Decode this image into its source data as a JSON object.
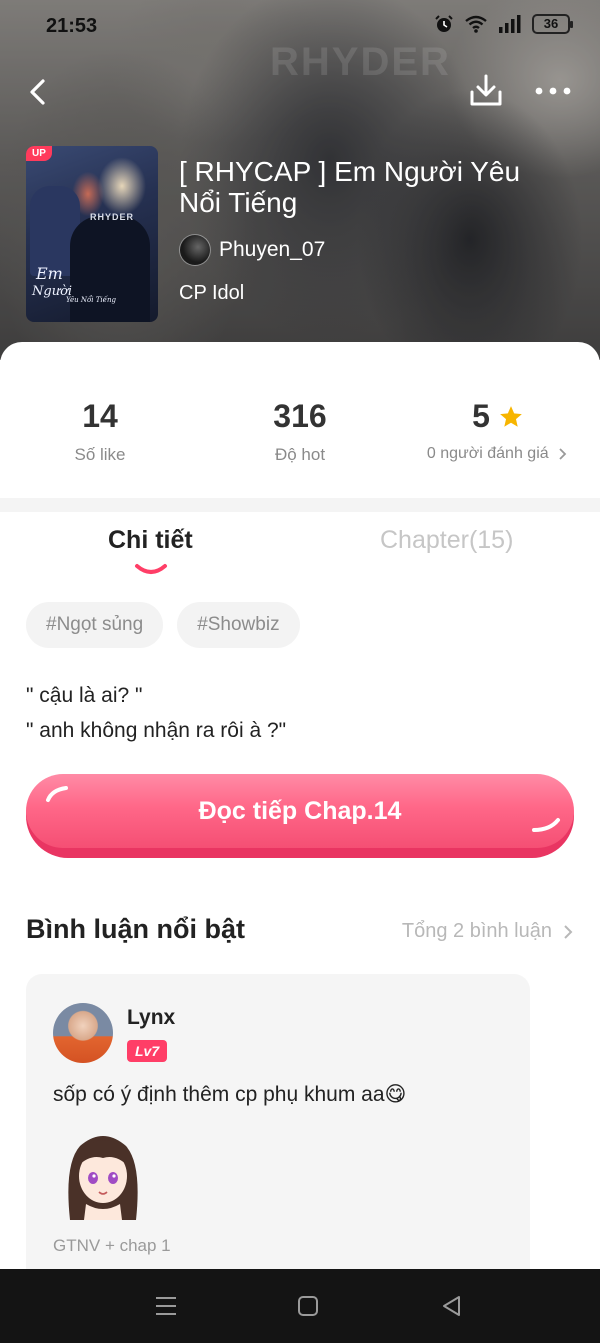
{
  "status_bar": {
    "time": "21:53",
    "battery": "36",
    "icons": [
      "alarm-icon",
      "wifi-icon",
      "signal-icon",
      "battery-icon"
    ]
  },
  "top_nav": {
    "icons": [
      "back-arrow-icon",
      "download-icon",
      "more-dots-icon"
    ]
  },
  "book": {
    "cover_badge": "UP",
    "cover_brand": "RHYDER",
    "cover_script_line1": "Em",
    "cover_script_line2": "Người",
    "cover_script_line3": "Yêu Nổi Tiếng",
    "title": "[ RHYCAP ] Em Người Yêu Nổi Tiếng",
    "author": "Phuyen_07",
    "genre": "CP Idol"
  },
  "stats": {
    "likes_value": "14",
    "likes_label": "Số like",
    "hot_value": "316",
    "hot_label": "Độ hot",
    "rating_value": "5",
    "rating_label": "0 người đánh giá",
    "rating_icon": "star-icon"
  },
  "tabs": [
    {
      "label": "Chi tiết",
      "active": true
    },
    {
      "label": "Chapter(15)",
      "active": false
    }
  ],
  "tags": [
    "#Ngọt sủng",
    "#Showbiz"
  ],
  "synopsis": {
    "line1": "\" cậu là ai? \"",
    "line2": "\" anh không nhận ra rôi à ?\""
  },
  "read_button": {
    "label": "Đọc tiếp Chap.14"
  },
  "comments": {
    "title": "Bình luận nổi bật",
    "total": "Tổng 2 bình luận",
    "items": [
      {
        "user": "Lynx",
        "level": "Lv7",
        "text": "sốp có ý định thêm cp phụ khum aa😋",
        "chapter": "GTNV + chap 1"
      }
    ]
  },
  "colors": {
    "accent": "#ff5c7f",
    "star": "#f7b500",
    "level_badge": "#ff3e67",
    "muted_text": "#8a8a8a"
  },
  "system_nav": {
    "icons": [
      "recents-icon",
      "home-icon",
      "back-triangle-icon"
    ]
  }
}
